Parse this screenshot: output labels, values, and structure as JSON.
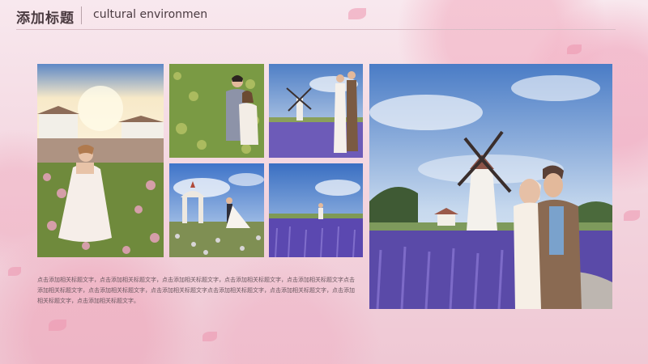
{
  "slide": {
    "title_cn": "添加标题",
    "title_en": "cultural environmen"
  },
  "photos": [
    {
      "name": "bride-in-flower-field-photo"
    },
    {
      "name": "couple-in-rapeseed-field-photo"
    },
    {
      "name": "couple-by-windmill-lavender-photo"
    },
    {
      "name": "couple-by-arch-gate-photo"
    },
    {
      "name": "lavender-field-couple-photo"
    },
    {
      "name": "couple-kissing-windmill-photo"
    }
  ],
  "body_text": "点击添加相关标题文字，点击添加相关标题文字，点击添加相关标题文字，点击添加相关标题文字，点击添加相关标题文字点击添加相关标题文字，点击添加相关标题文字，点击添加相关标题文字点击添加相关标题文字，点击添加相关标题文字，点击添加相关标题文字，点击添加相关标题文字。",
  "colors": {
    "background": "#f4d9e1",
    "title": "#4a3a40",
    "body_text": "#6b5860"
  }
}
